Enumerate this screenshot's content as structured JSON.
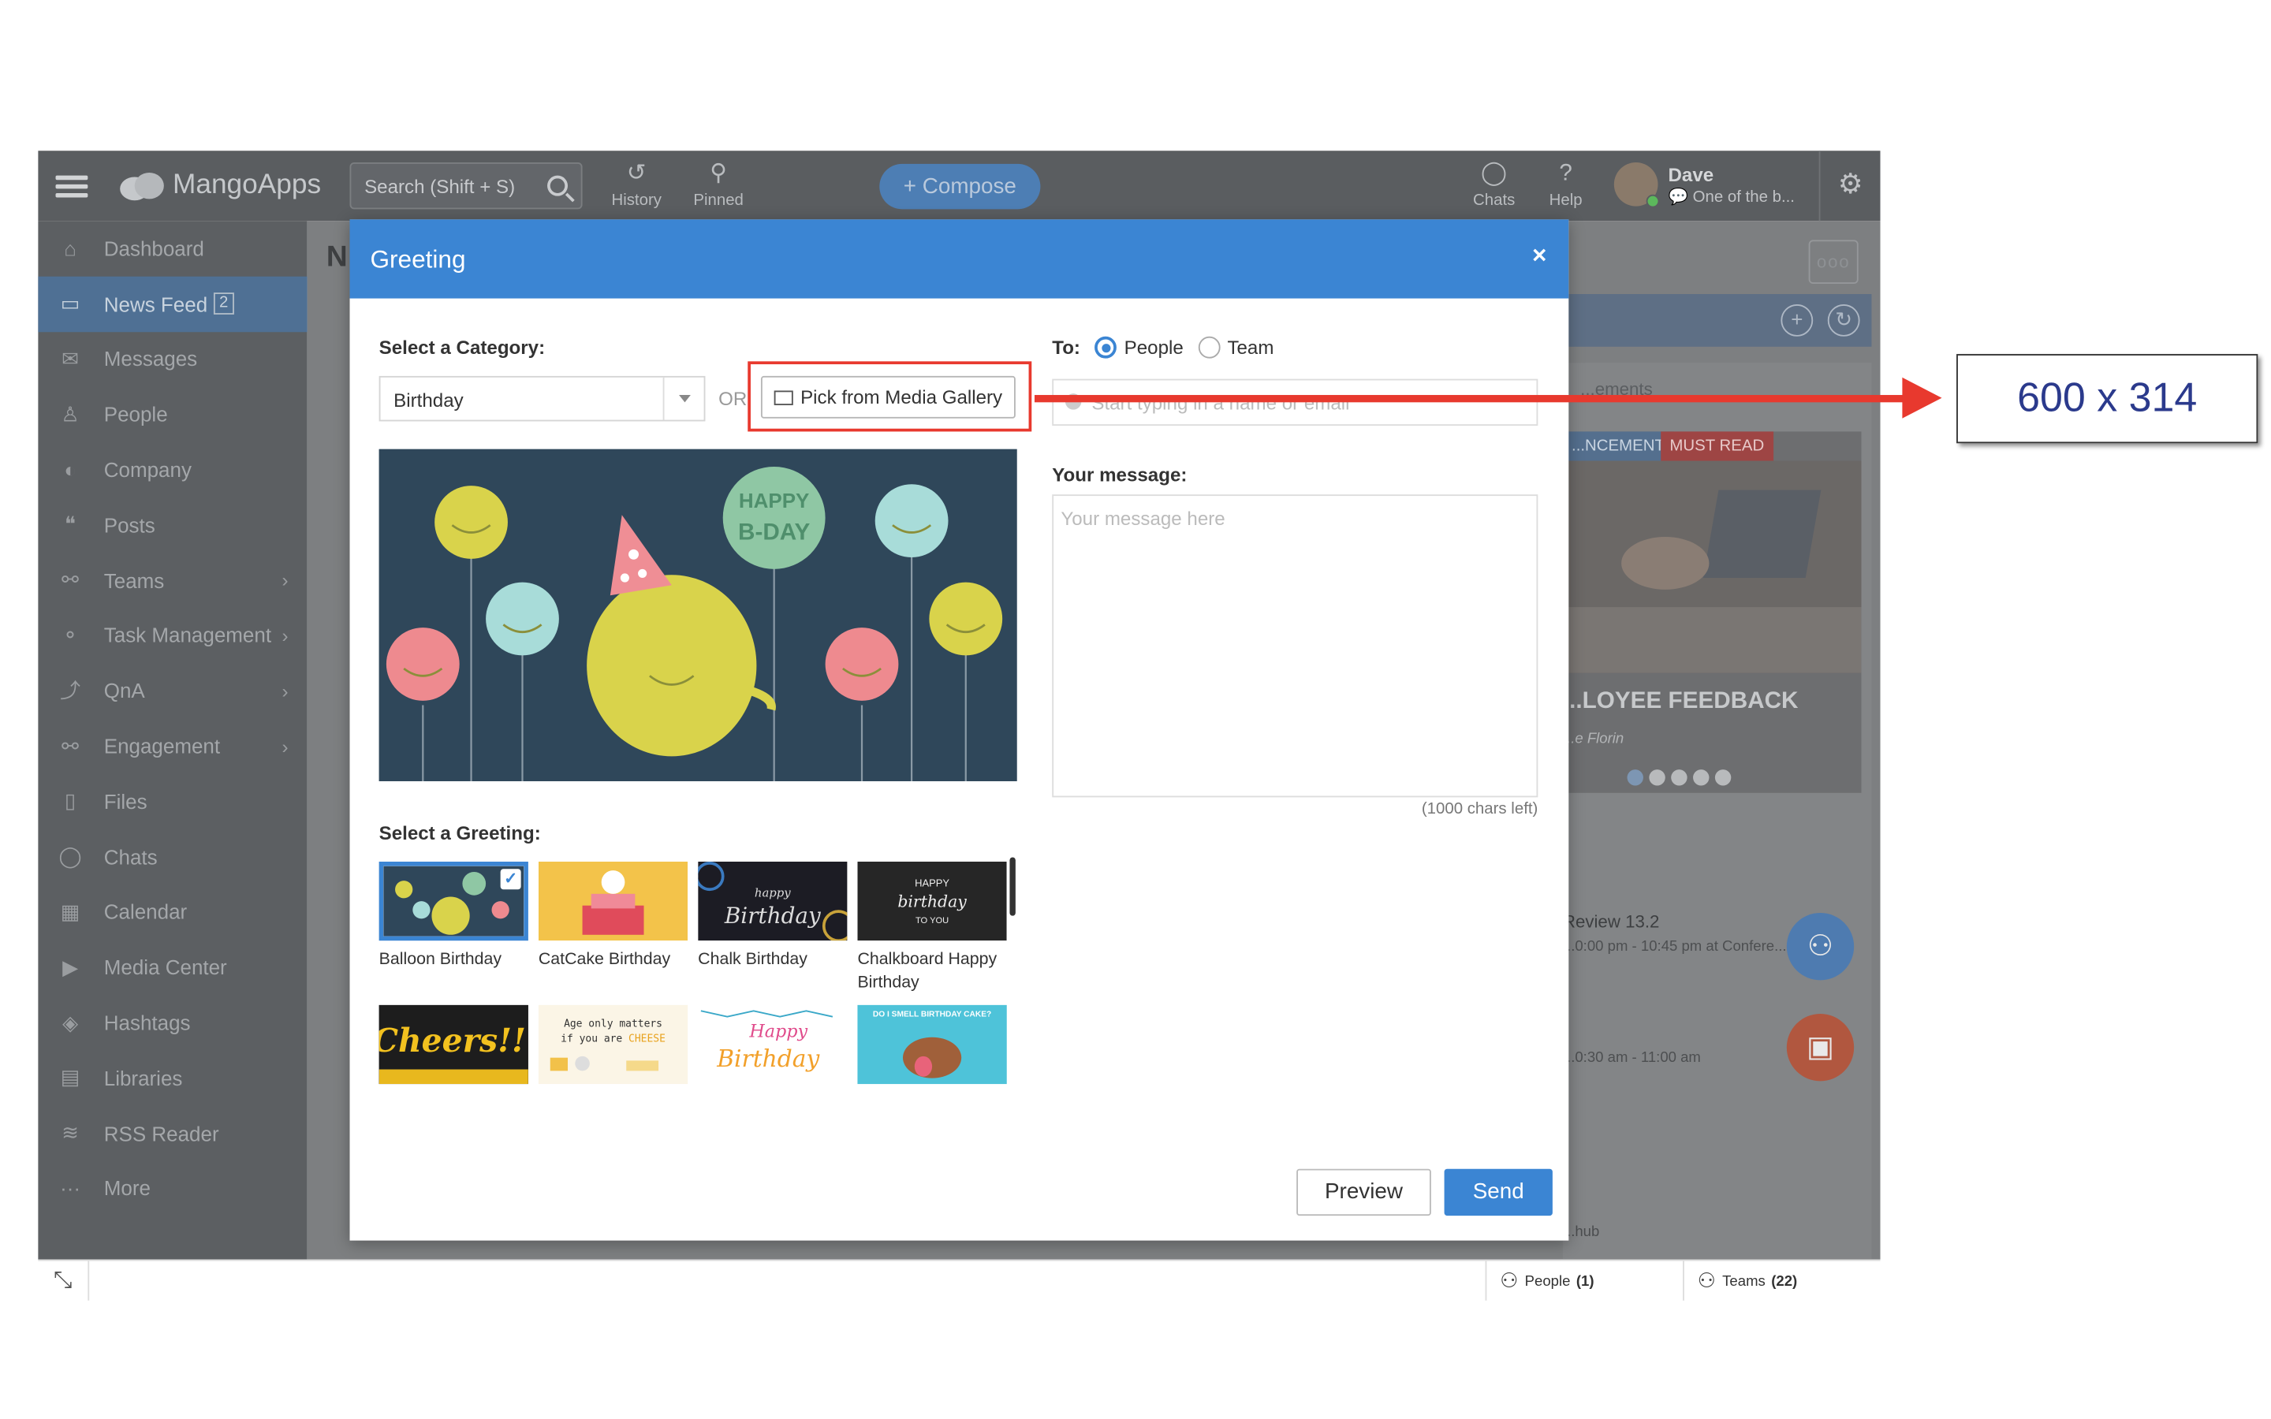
{
  "app": {
    "logo_text": "MangoApps"
  },
  "topbar": {
    "search_placeholder": "Search (Shift + S)",
    "history_label": "History",
    "pinned_label": "Pinned",
    "compose_label": "+ Compose",
    "chats_label": "Chats",
    "help_label": "Help",
    "user_name": "Dave",
    "user_status": "One of the b..."
  },
  "sidebar": {
    "items": [
      {
        "label": "Dashboard",
        "icon": "home-icon"
      },
      {
        "label": "News Feed",
        "icon": "inbox-icon",
        "badge": "2",
        "active": true
      },
      {
        "label": "Messages",
        "icon": "envelope-icon"
      },
      {
        "label": "People",
        "icon": "person-icon"
      },
      {
        "label": "Company",
        "icon": "globe-icon"
      },
      {
        "label": "Posts",
        "icon": "quote-icon"
      },
      {
        "label": "Teams",
        "icon": "handshake-icon",
        "chevron": true
      },
      {
        "label": "Task Management",
        "icon": "hierarchy-icon",
        "chevron": true
      },
      {
        "label": "QnA",
        "icon": "chart-icon",
        "chevron": true
      },
      {
        "label": "Engagement",
        "icon": "handshake-icon",
        "chevron": true
      },
      {
        "label": "Files",
        "icon": "file-icon"
      },
      {
        "label": "Chats",
        "icon": "chat-bubble-icon"
      },
      {
        "label": "Calendar",
        "icon": "calendar-icon"
      },
      {
        "label": "Media Center",
        "icon": "video-icon"
      },
      {
        "label": "Hashtags",
        "icon": "tag-icon"
      },
      {
        "label": "Libraries",
        "icon": "library-icon"
      },
      {
        "label": "RSS Reader",
        "icon": "rss-icon"
      },
      {
        "label": "More",
        "icon": "dots-icon"
      }
    ]
  },
  "main": {
    "title_fragment": "N",
    "more_label": "ooo",
    "announcements_label": "...ements",
    "tag_announcement": "...NCEMENT",
    "tag_must_read": "MUST READ",
    "banner_title": "...LOYEE FEEDBACK",
    "banner_author": "...e Florin",
    "event1_title": "Review 13.2",
    "event1_time": "...0:00 pm - 10:45 pm at Confere...",
    "event2_time": "...0:30 am - 11:00 am",
    "hub_label": "...hub"
  },
  "bottombar": {
    "people_label": "People",
    "people_count": "(1)",
    "teams_label": "Teams",
    "teams_count": "(22)"
  },
  "modal": {
    "title": "Greeting",
    "close_label": "×",
    "category_label": "Select a Category:",
    "category_value": "Birthday",
    "or_label": "OR",
    "media_gallery_label": "Pick from Media Gallery",
    "to_label": "To:",
    "to_people": "People",
    "to_team": "Team",
    "to_placeholder": "Start typing in a name or email",
    "message_label": "Your message:",
    "message_placeholder": "Your message here",
    "chars_left": "(1000 chars left)",
    "greeting_label": "Select a Greeting:",
    "preview_text": "HAPPY B-DAY",
    "greetings": [
      {
        "caption": "Balloon Birthday",
        "selected": true
      },
      {
        "caption": "CatCake Birthday"
      },
      {
        "caption": "Chalk Birthday"
      },
      {
        "caption": "Chalkboard Happy Birthday"
      },
      {
        "caption": "",
        "art_text": "Cheers!!"
      },
      {
        "caption": "",
        "art_text": "Age only matters if you are CHEESE"
      },
      {
        "caption": "",
        "art_text": "Happy Birthday"
      },
      {
        "caption": "",
        "art_text": "DO I SMELL BIRTHDAY CAKE?"
      }
    ],
    "preview_button": "Preview",
    "send_button": "Send"
  },
  "annotation": {
    "dimensions": "600 x 314",
    "arrow_color": "#e8392e"
  }
}
